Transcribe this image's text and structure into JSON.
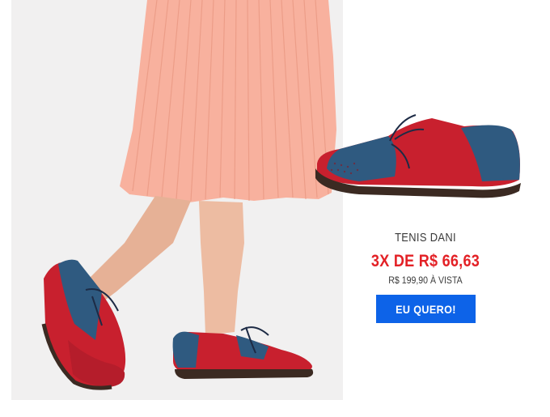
{
  "product": {
    "name": "TENIS DANI",
    "installment_price": "3X DE R$ 66,63",
    "cash_price": "R$ 199,90 À VISTA",
    "cta_label": "EU QUERO!"
  },
  "colors": {
    "accent_red": "#e32126",
    "button_blue": "#0d63e8",
    "text_gray": "#3a3a3a",
    "photo_background": "#f1f0f0"
  }
}
